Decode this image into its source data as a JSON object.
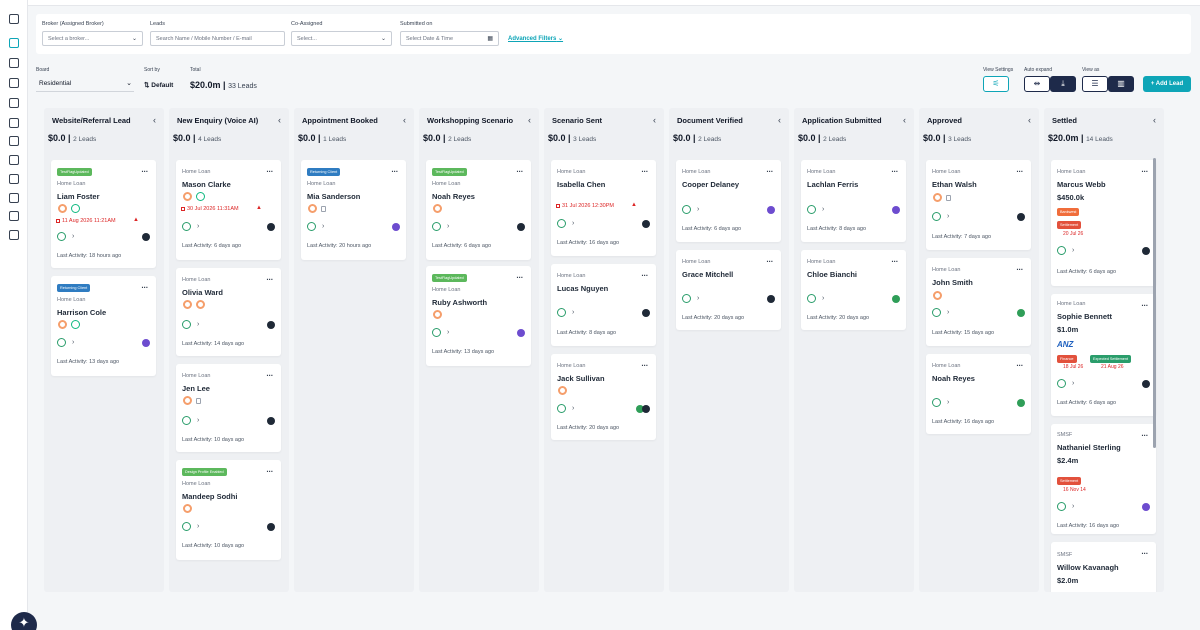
{
  "filters": {
    "broker": {
      "label": "Broker (Assigned Broker)",
      "placeholder": "Select a broker..."
    },
    "leads": {
      "label": "Leads",
      "placeholder": "Search Name / Mobile Number / E-mail"
    },
    "co_assigned": {
      "label": "Co-Assigned",
      "placeholder": "Select..."
    },
    "submitted_on": {
      "label": "Submitted on",
      "placeholder": "Select Date & Time"
    },
    "advanced": "Advanced Filters"
  },
  "board": {
    "board_label": "Board",
    "board_value": "Residential",
    "sort_label": "Sort by",
    "sort_value": "Default",
    "total_label": "Total",
    "total_value": "$20.0m",
    "total_count": "33 Leads",
    "view_settings_label": "View Settings",
    "auto_expand_label": "Auto expand",
    "view_as_label": "View as",
    "add_lead": "+ Add Lead"
  },
  "columns": [
    {
      "title": "Website/Referral Lead",
      "amount": "$0.0",
      "count": "2 Leads",
      "cards": [
        {
          "tag": "TestFlagUpdated",
          "tag_color": "green",
          "type": "Home Loan",
          "name": "Liam Foster",
          "date": "11 Aug 2026 11:21AM",
          "rings": 2,
          "activity": "Last Activity: 18 hours ago",
          "avatar": "dark"
        },
        {
          "tag": "Returning Client",
          "tag_color": "blue",
          "type": "Home Loan",
          "name": "Harrison Cole",
          "rings": 2,
          "activity": "Last Activity: 13 days ago",
          "avatar": "purple"
        }
      ]
    },
    {
      "title": "New Enquiry (Voice AI)",
      "amount": "$0.0",
      "count": "4 Leads",
      "cards": [
        {
          "type": "Home Loan",
          "name": "Mason Clarke",
          "date": "30 Jul 2026 11:31AM",
          "rings": 2,
          "activity": "Last Activity: 6 days ago",
          "avatar": "dark"
        },
        {
          "type": "Home Loan",
          "name": "Olivia Ward",
          "rings": 2,
          "activity": "Last Activity: 14 days ago",
          "avatar": "dark"
        },
        {
          "type": "Home Loan",
          "name": "Jen Lee",
          "rings": 1,
          "activity": "Last Activity: 10 days ago",
          "avatar": "dark"
        },
        {
          "tag": "Design Profile Enabled",
          "tag_color": "green",
          "type": "Home Loan",
          "name": "Mandeep Sodhi",
          "rings": 1,
          "activity": "Last Activity: 10 days ago",
          "avatar": "dark"
        }
      ]
    },
    {
      "title": "Appointment Booked",
      "amount": "$0.0",
      "count": "1 Leads",
      "cards": [
        {
          "tag": "Returning Client",
          "tag_color": "blue",
          "type": "Home Loan",
          "name": "Mia Sanderson",
          "rings": 1,
          "activity": "Last Activity: 20 hours ago",
          "avatar": "purple"
        }
      ]
    },
    {
      "title": "Workshopping Scenario",
      "amount": "$0.0",
      "count": "2 Leads",
      "cards": [
        {
          "tag": "TestFlagUpdated",
          "tag_color": "green",
          "type": "Home Loan",
          "name": "Noah Reyes",
          "rings": 1,
          "activity": "Last Activity: 6 days ago",
          "avatar": "dark"
        },
        {
          "tag": "TestFlagUpdated",
          "tag_color": "green",
          "type": "Home Loan",
          "name": "Ruby Ashworth",
          "rings": 1,
          "activity": "Last Activity: 13 days ago",
          "avatar": "purple"
        }
      ]
    },
    {
      "title": "Scenario Sent",
      "amount": "$0.0",
      "count": "3 Leads",
      "cards": [
        {
          "type": "Home Loan",
          "name": "Isabella Chen",
          "date": "31 Jul 2026 12:30PM",
          "activity": "Last Activity: 16 days ago",
          "avatar": "dark"
        },
        {
          "type": "Home Loan",
          "name": "Lucas Nguyen",
          "activity": "Last Activity: 8 days ago",
          "avatar": "dark"
        },
        {
          "type": "Home Loan",
          "name": "Jack Sullivan",
          "rings": 1,
          "activity": "Last Activity: 20 days ago",
          "avatar": "green"
        }
      ]
    },
    {
      "title": "Document Verified",
      "amount": "$0.0",
      "count": "2 Leads",
      "cards": [
        {
          "type": "Home Loan",
          "name": "Cooper Delaney",
          "activity": "Last Activity: 6 days ago",
          "avatar": "purple"
        },
        {
          "type": "Home Loan",
          "name": "Grace Mitchell",
          "activity": "Last Activity: 20 days ago",
          "avatar": "dark"
        }
      ]
    },
    {
      "title": "Application Submitted",
      "amount": "$0.0",
      "count": "2 Leads",
      "cards": [
        {
          "type": "Home Loan",
          "name": "Lachlan Ferris",
          "activity": "Last Activity: 8 days ago",
          "avatar": "purple"
        },
        {
          "type": "Home Loan",
          "name": "Chloe Bianchi",
          "activity": "Last Activity: 20 days ago",
          "avatar": "green"
        }
      ]
    },
    {
      "title": "Approved",
      "amount": "$0.0",
      "count": "3 Leads",
      "cards": [
        {
          "type": "Home Loan",
          "name": "Ethan Walsh",
          "rings": 1,
          "activity": "Last Activity: 7 days ago",
          "avatar": "dark"
        },
        {
          "type": "Home Loan",
          "name": "John Smith",
          "rings": 1,
          "activity": "Last Activity: 15 days ago",
          "avatar": "green"
        },
        {
          "type": "Home Loan",
          "name": "Noah Reyes",
          "activity": "Last Activity: 16 days ago",
          "avatar": "green"
        }
      ]
    },
    {
      "title": "Settled",
      "amount": "$20.0m",
      "count": "14 Leads",
      "cards": [
        {
          "type": "Home Loan",
          "name": "Marcus Webb",
          "value": "$450.0k",
          "tag": "Bankwest",
          "tag_color": "orange",
          "tag2": "Settlement",
          "tag2_date": "20 Jul 26",
          "activity": "Last Activity: 6 days ago",
          "avatar": "dark"
        },
        {
          "type": "Home Loan",
          "name": "Sophie Bennett",
          "value": "$1.0m",
          "lender": "ANZ",
          "tag": "Finance",
          "tag_color": "red",
          "tag_date": "18 Jul 26",
          "tag2": "Expected Settlement",
          "tag2_date": "21 Aug 26",
          "activity": "Last Activity: 6 days ago",
          "avatar": "dark"
        },
        {
          "type": "SMSF",
          "name": "Nathaniel Sterling",
          "value": "$2.4m",
          "tag": "Settlement",
          "tag_color": "red",
          "tag_date": "16 Nov 14",
          "activity": "Last Activity: 16 days ago",
          "avatar": "purple"
        },
        {
          "type": "SMSF",
          "name": "Willow Kavanagh",
          "value": "$2.0m"
        }
      ]
    }
  ]
}
